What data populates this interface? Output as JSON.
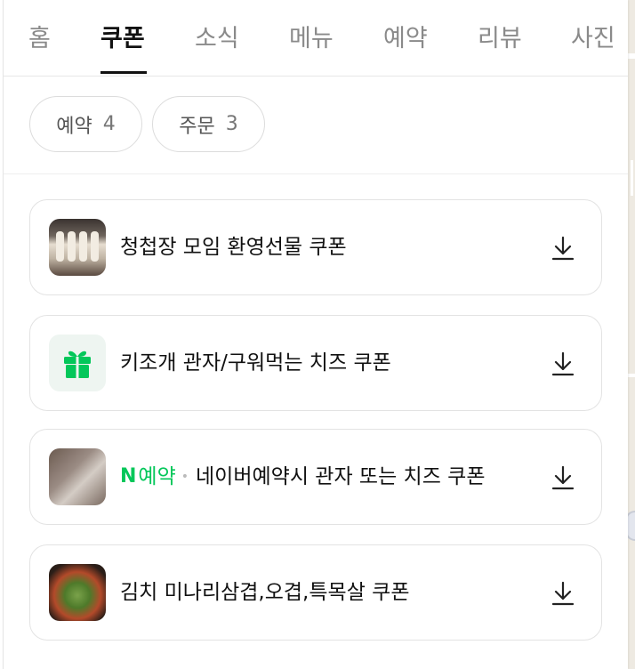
{
  "tabs": [
    {
      "label": "홈",
      "active": false
    },
    {
      "label": "쿠폰",
      "active": true
    },
    {
      "label": "소식",
      "active": false
    },
    {
      "label": "메뉴",
      "active": false
    },
    {
      "label": "예약",
      "active": false
    },
    {
      "label": "리뷰",
      "active": false
    },
    {
      "label": "사진",
      "active": false
    }
  ],
  "filters": [
    {
      "label": "예약",
      "count": "4"
    },
    {
      "label": "주문",
      "count": "3"
    }
  ],
  "coupons": [
    {
      "title": "청첩장 모임 환영선물 쿠폰",
      "thumbnail": "food-photo",
      "action_icon": "download-icon"
    },
    {
      "title": "키조개 관자/구워먹는 치즈 쿠폰",
      "thumbnail": "gift-icon",
      "action_icon": "download-icon"
    },
    {
      "title": "네이버예약시 관자 또는 치즈 쿠폰",
      "badge": {
        "mark": "N",
        "label": "예약"
      },
      "thumbnail": "food-photo",
      "action_icon": "download-icon"
    },
    {
      "title": "김치 미나리삼겹,오겹,특목살 쿠폰",
      "thumbnail": "food-photo",
      "action_icon": "download-icon"
    }
  ],
  "colors": {
    "accent_green": "#03c75a",
    "tab_active": "#111111",
    "tab_inactive": "#8a8a8a"
  }
}
